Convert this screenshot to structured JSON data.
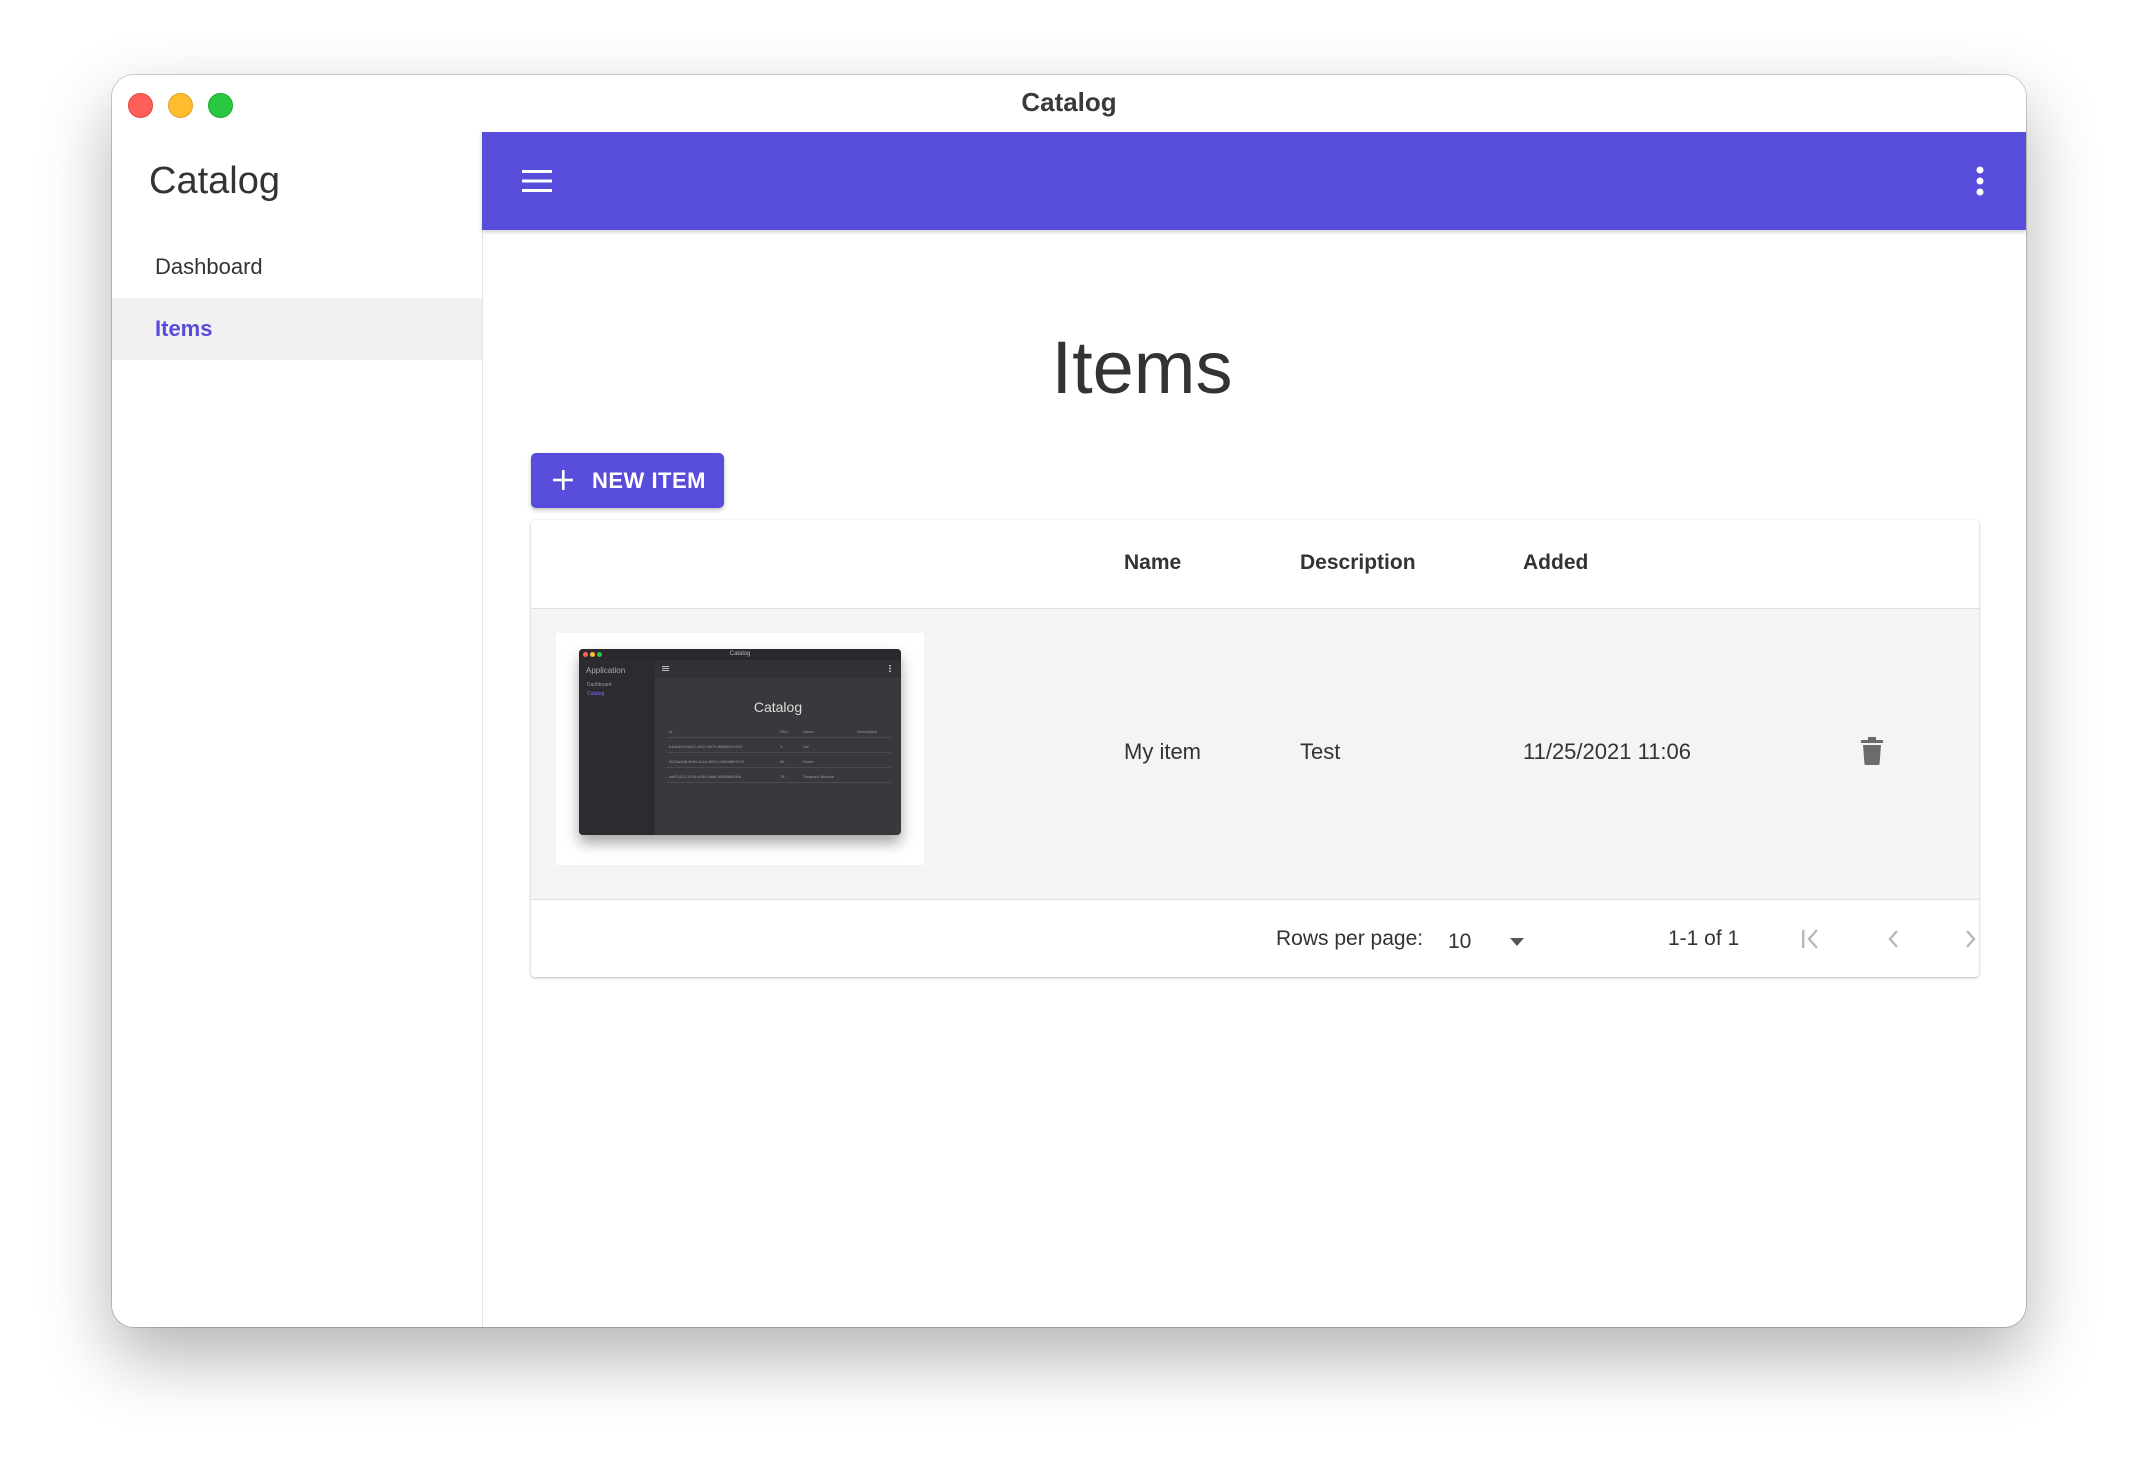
{
  "window": {
    "title": "Catalog"
  },
  "sidebar": {
    "title": "Catalog",
    "items": [
      {
        "label": "Dashboard",
        "active": false
      },
      {
        "label": "Items",
        "active": true
      }
    ]
  },
  "appbar": {
    "menu_icon": "hamburger-menu-icon",
    "more_icon": "more-vertical-icon",
    "color": "#584ddb"
  },
  "main": {
    "title": "Items",
    "new_item_label": "NEW ITEM",
    "table": {
      "columns": [
        "Name",
        "Description",
        "Added"
      ],
      "rows": [
        {
          "name": "My item",
          "description": "Test",
          "added": "11/25/2021 11:06",
          "thumbnail": {
            "window_title": "Catalog",
            "sidebar_title": "Application",
            "sidebar_items": [
              "Dashboard",
              "Catalog"
            ],
            "content_title": "Catalog",
            "columns": [
              "Id",
              "SKU",
              "Name",
              "Description"
            ],
            "rows": [
              [
                "b4ad42ef-9d21-4627-8379-f6f65697c902",
                "1",
                "Val",
                ""
              ],
              [
                "9023add6-9b04-41ed-897d-1f36dd8b7e72",
                "66",
                "Some",
                ""
              ],
              [
                "aa971021-f159-4d34-bb66-d4f3f5fb530e",
                "78",
                "Treasure Medium",
                ""
              ]
            ]
          }
        }
      ],
      "footer": {
        "rows_per_page_label": "Rows per page:",
        "rows_per_page_value": "10",
        "range_text": "1-1 of 1"
      }
    }
  },
  "colors": {
    "accent": "#584ddb",
    "active_nav_text": "#5a4cdb"
  }
}
